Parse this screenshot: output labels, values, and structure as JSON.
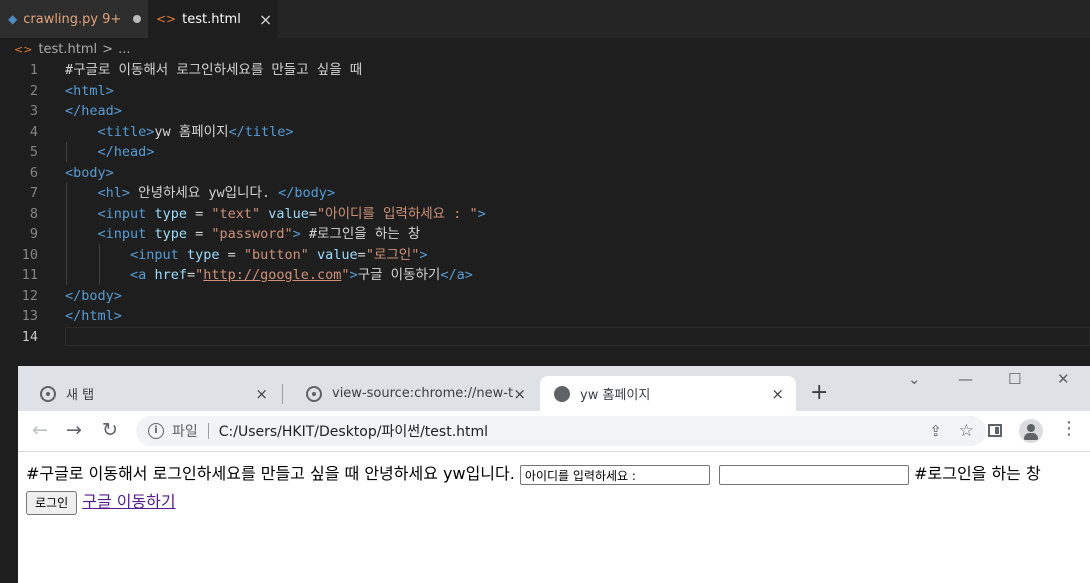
{
  "vscode": {
    "tabs": [
      {
        "name": "crawling.py",
        "badge": "9+",
        "icon": "python-file-icon"
      },
      {
        "name": "test.html",
        "icon": "html-file-icon",
        "close": "×"
      }
    ],
    "breadcrumb": {
      "file": "test.html",
      "sep": ">",
      "more": "..."
    },
    "lines": [
      {
        "n": "1",
        "code": [
          [
            "tx",
            "#구글로 이동해서 로그인하세요를 만들고 싶을 때"
          ]
        ]
      },
      {
        "n": "2",
        "code": [
          [
            "tg",
            "<html>"
          ]
        ]
      },
      {
        "n": "3",
        "code": [
          [
            "tg",
            "</head>"
          ]
        ]
      },
      {
        "n": "4",
        "code": [
          [
            "tx",
            "    "
          ],
          [
            "tg",
            "<title>"
          ],
          [
            "tx",
            "yw 홈페이지"
          ],
          [
            "tg",
            "</title>"
          ]
        ]
      },
      {
        "n": "5",
        "code": [
          [
            "tx",
            "    "
          ],
          [
            "tg",
            "</head>"
          ]
        ]
      },
      {
        "n": "6",
        "code": [
          [
            "tg",
            "<body>"
          ]
        ]
      },
      {
        "n": "7",
        "code": [
          [
            "tx",
            "    "
          ],
          [
            "tg",
            "<hl>"
          ],
          [
            "tx",
            " 안녕하세요 yw입니다. "
          ],
          [
            "tg",
            "</body>"
          ]
        ]
      },
      {
        "n": "8",
        "code": [
          [
            "tx",
            "    "
          ],
          [
            "tg",
            "<input"
          ],
          [
            "tx",
            " "
          ],
          [
            "at",
            "type"
          ],
          [
            "tx",
            " = "
          ],
          [
            "st",
            "\"text\""
          ],
          [
            "tx",
            " "
          ],
          [
            "at",
            "value"
          ],
          [
            "tx",
            "="
          ],
          [
            "st",
            "\"아이디를 입력하세요 : \""
          ],
          [
            "tg",
            ">"
          ]
        ]
      },
      {
        "n": "9",
        "code": [
          [
            "tx",
            "    "
          ],
          [
            "tg",
            "<input"
          ],
          [
            "tx",
            " "
          ],
          [
            "at",
            "type"
          ],
          [
            "tx",
            " = "
          ],
          [
            "st",
            "\"password\""
          ],
          [
            "tg",
            ">"
          ],
          [
            "tx",
            " #로그인을 하는 창"
          ]
        ]
      },
      {
        "n": "10",
        "code": [
          [
            "tx",
            "        "
          ],
          [
            "tg",
            "<input"
          ],
          [
            "tx",
            " "
          ],
          [
            "at",
            "type"
          ],
          [
            "tx",
            " = "
          ],
          [
            "st",
            "\"button\""
          ],
          [
            "tx",
            " "
          ],
          [
            "at",
            "value"
          ],
          [
            "tx",
            "="
          ],
          [
            "st",
            "\"로그인\""
          ],
          [
            "tg",
            ">"
          ]
        ]
      },
      {
        "n": "11",
        "code": [
          [
            "tx",
            "        "
          ],
          [
            "tg",
            "<a"
          ],
          [
            "tx",
            " "
          ],
          [
            "at",
            "href"
          ],
          [
            "tx",
            "="
          ],
          [
            "st",
            "\""
          ],
          [
            "lk",
            "http://google.com"
          ],
          [
            "st",
            "\""
          ],
          [
            "tg",
            ">"
          ],
          [
            "tx",
            "구글 이동하기"
          ],
          [
            "tg",
            "</a>"
          ]
        ]
      },
      {
        "n": "12",
        "code": [
          [
            "tg",
            "</body>"
          ]
        ]
      },
      {
        "n": "13",
        "code": [
          [
            "tg",
            "</html>"
          ]
        ]
      },
      {
        "n": "14",
        "code": []
      }
    ],
    "active_line": "14"
  },
  "chrome": {
    "tabs": [
      {
        "title": "새 탭",
        "close": "×"
      },
      {
        "title": "view-source:chrome://new-tab-page/",
        "close": "×"
      },
      {
        "title": "yw 홈페이지",
        "close": "×"
      }
    ],
    "new_tab": "+",
    "window_controls": {
      "minimize": "—",
      "maximize": "☐",
      "close": "✕",
      "tabsearch": "⌄"
    },
    "nav": {
      "back": "←",
      "forward": "→",
      "reload": "↻"
    },
    "omnibox": {
      "info_label": "파일",
      "url": "C:/Users/HKIT/Desktop/파이썬/test.html",
      "share": "⇪",
      "star": "☆"
    },
    "menu": "⋮",
    "page": {
      "text1": "#구글로 이동해서 로그인하세요를 만들고 싶을 때 안녕하세요 yw입니다.",
      "text_input_value": "아이디를 입력하세요 :",
      "password_value": "",
      "text2": "#로그인을 하는 창",
      "button_label": "로그인",
      "link_text": "구글 이동하기"
    }
  },
  "colors": {
    "editor_bg": "#1e1e1e",
    "tag": "#569cd6",
    "attr": "#9cdcfe",
    "string": "#ce9178",
    "link_visited": "#551a8b"
  }
}
